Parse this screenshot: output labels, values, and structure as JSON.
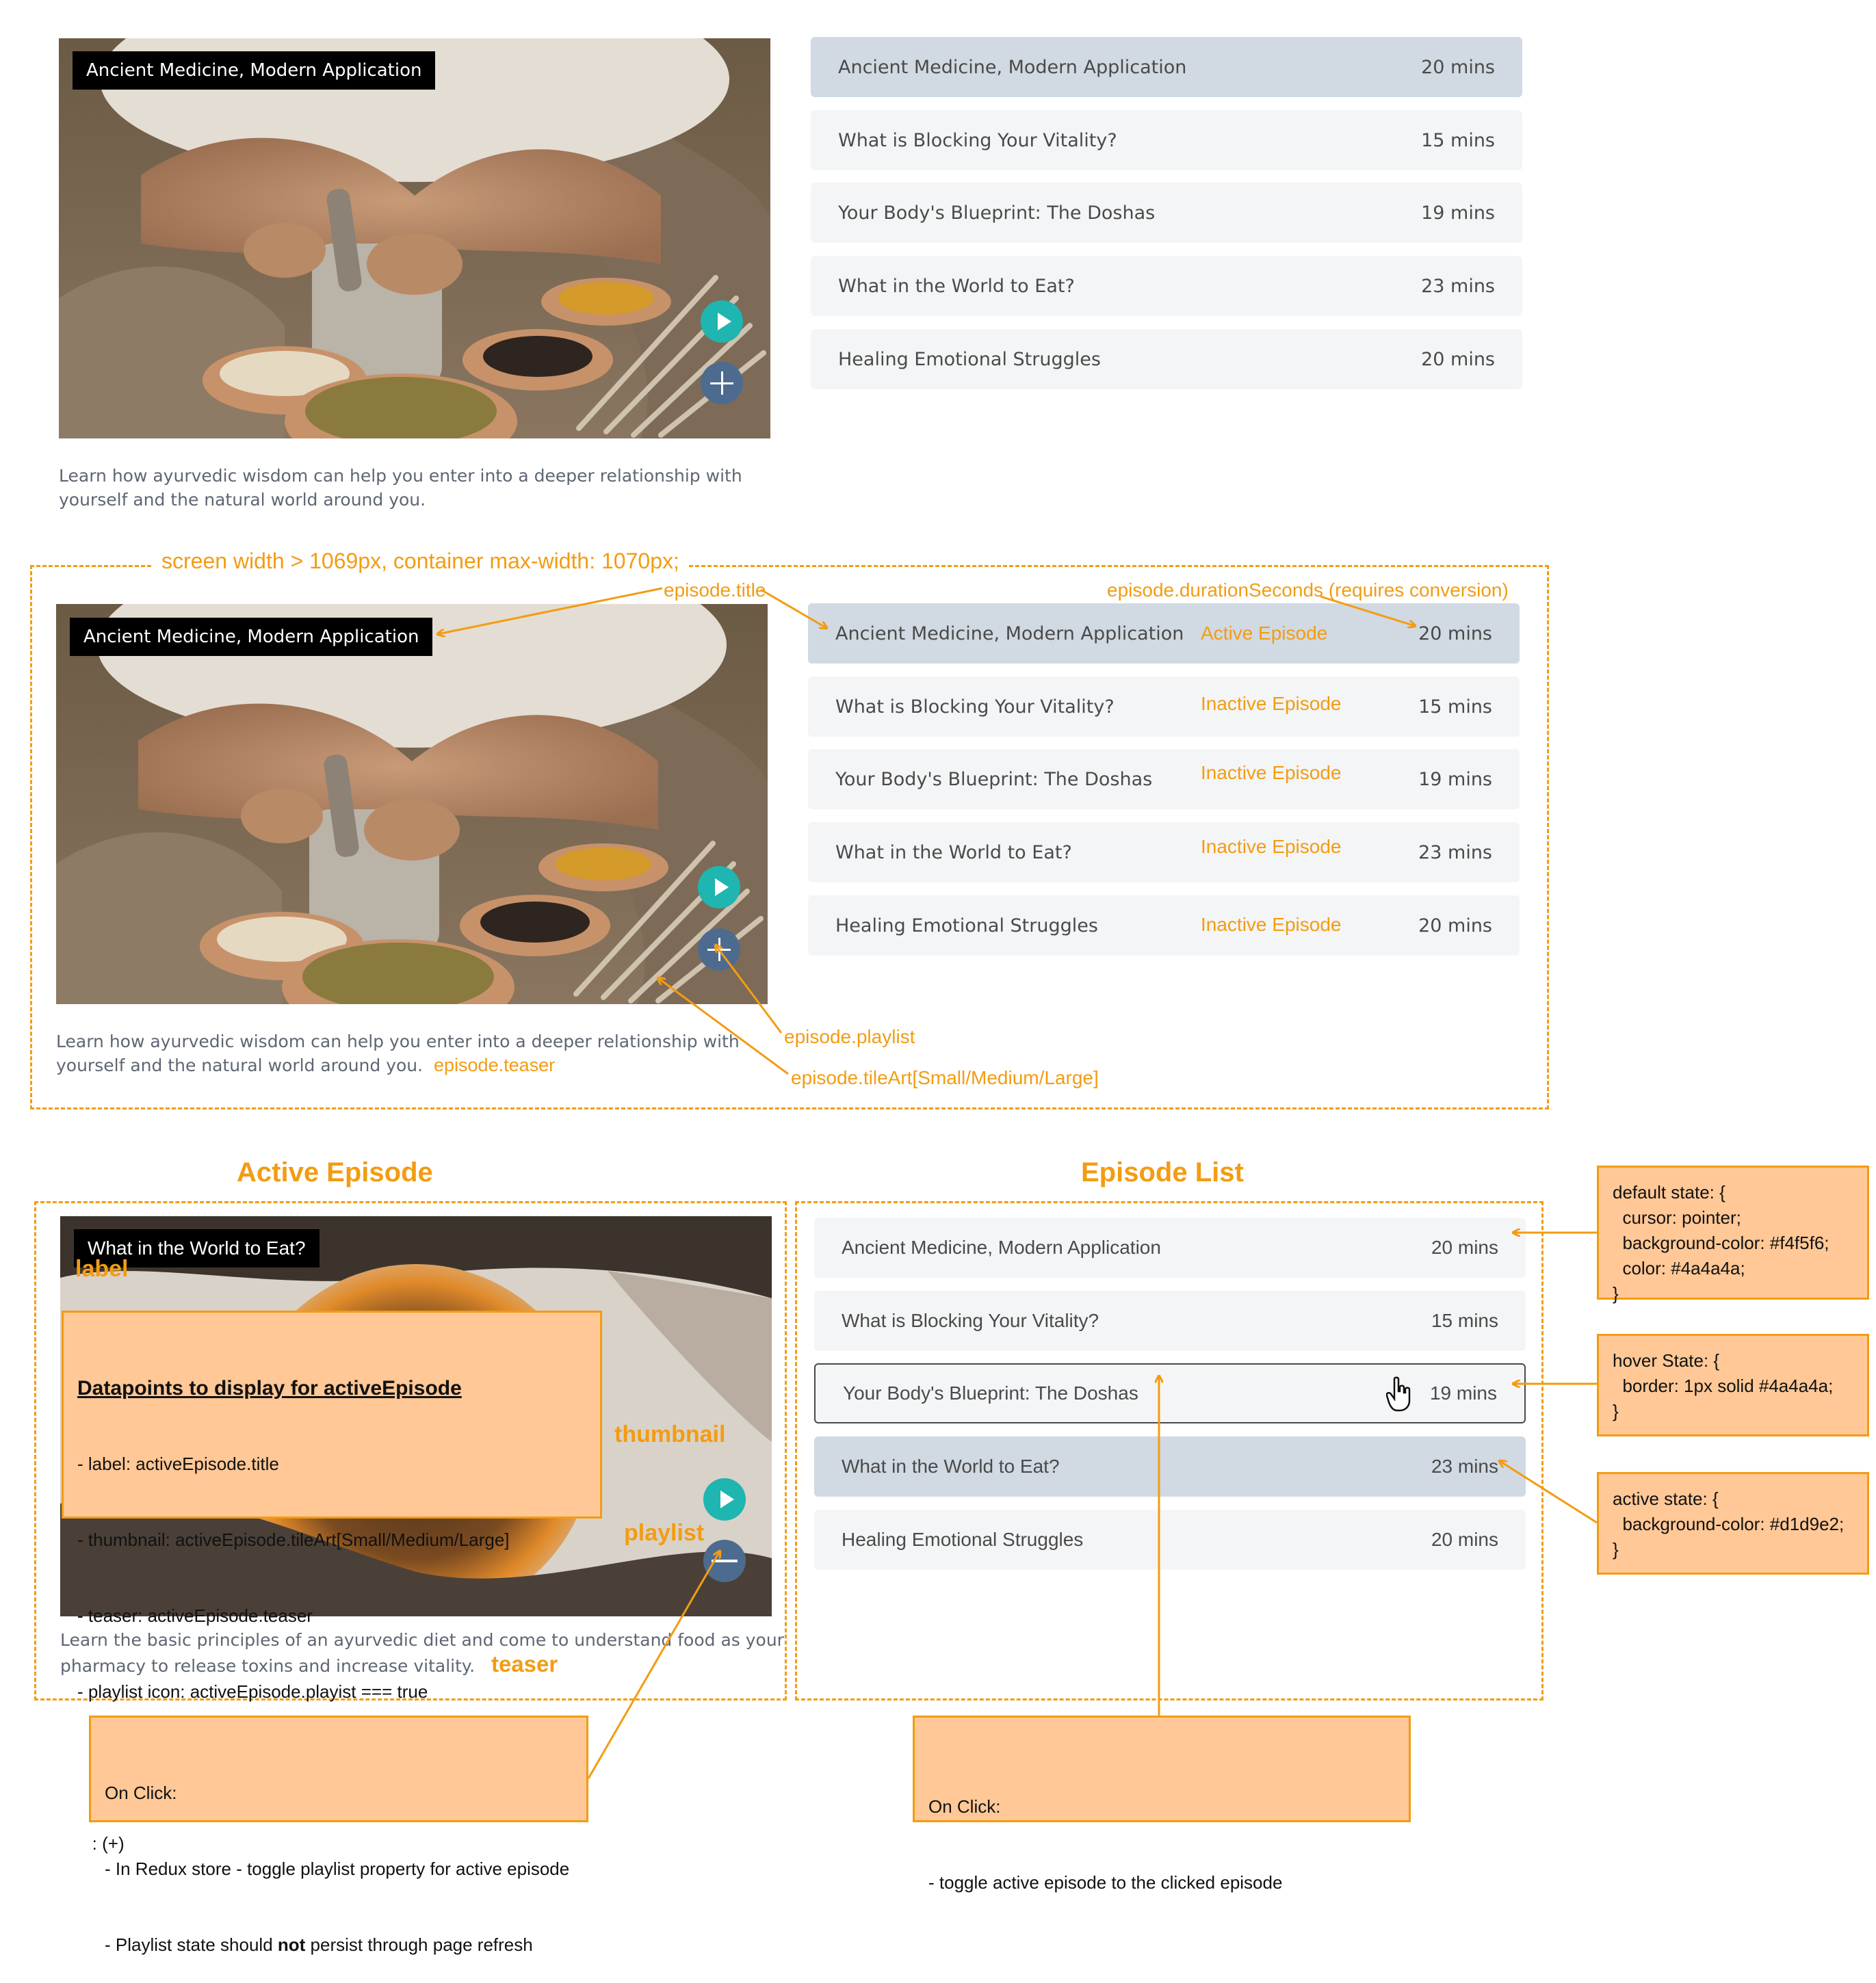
{
  "section1": {
    "label": "Ancient Medicine, Modern Application",
    "teaser_line1": "Learn how ayurvedic wisdom can help you enter into a deeper relationship with",
    "teaser_line2": "yourself and the natural world around you."
  },
  "episodes": [
    {
      "title": "Ancient Medicine, Modern Application",
      "duration": "20 mins"
    },
    {
      "title": "What is Blocking Your Vitality?",
      "duration": "15 mins"
    },
    {
      "title": "Your Body's Blueprint: The Doshas",
      "duration": "19 mins"
    },
    {
      "title": "What in the World to Eat?",
      "duration": "23 mins"
    },
    {
      "title": "Healing Emotional Struggles",
      "duration": "20 mins"
    }
  ],
  "section2": {
    "container_note": "screen width > 1069px, container max-width: 1070px;",
    "ann_title": "episode.title",
    "ann_duration": "episode.durationSeconds (requires conversion)",
    "ann_playlist": "episode.playlist",
    "ann_tileart": "episode.tileArt[Small/Medium/Large]",
    "ann_teaser": "episode.teaser",
    "state_active": "Active Episode",
    "state_inactive": "Inactive Episode"
  },
  "section3": {
    "active_heading": "Active Episode",
    "list_heading": "Episode List",
    "label": "What in the World to Eat?",
    "ann_label": "label",
    "ann_thumbnail": "thumbnail",
    "ann_playlist": "playlist",
    "ann_teaser": "teaser",
    "teaser_line1": "Learn the basic principles of an ayurvedic diet and come to understand food as your",
    "teaser_line2": "pharmacy to release toxins and increase vitality.",
    "datapoints_title": "Datapoints to display for activeEpisode",
    "datapoints_lines": [
      "- label: activeEpisode.title",
      "- thumbnail: activeEpisode.tileArt[Small/Medium/Large]",
      "- teaser: activeEpisode.teaser",
      "- playlist icon: activeEpisode.playist === true",
      "   ? (-)",
      "   : (+)"
    ],
    "default_state": "default state: {\n  cursor: pointer;\n  background-color: #f4f5f6;\n  color: #4a4a4a;\n}",
    "hover_state": "hover State: {\n  border: 1px solid #4a4a4a;\n}",
    "active_state": "active state: {\n  background-color: #d1d9e2;\n}",
    "onclick_playlist_line1": "On Click:",
    "onclick_playlist_line2": "- In Redux store - toggle playlist property for active episode",
    "onclick_playlist_line3a": "- Playlist state should ",
    "onclick_playlist_line3b": "not",
    "onclick_playlist_line3c": " persist through page refresh",
    "onclick_list_line1": "On Click:",
    "onclick_list_line2": "- toggle active episode to the clicked episode"
  },
  "colors": {
    "annotation": "#f39c12",
    "row_default": "#f4f5f6",
    "row_active": "#d1d9e2",
    "text": "#4a4a4a",
    "play": "#1fb5b0",
    "playlist": "#4d6b8f"
  }
}
